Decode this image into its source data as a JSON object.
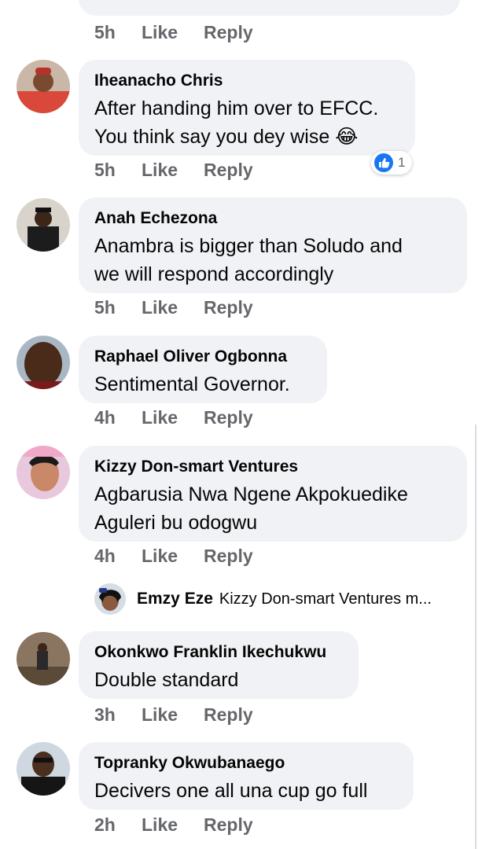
{
  "top_actions": {
    "time": "5h",
    "like": "Like",
    "reply": "Reply"
  },
  "comments": [
    {
      "author": "Iheanacho Chris",
      "lines": [
        "After handing him over to EFCC.",
        "You think say you dey wise 😂"
      ],
      "time": "5h",
      "like": "Like",
      "reply": "Reply",
      "reaction_count": "1"
    },
    {
      "author": "Anah Echezona",
      "lines": [
        "Anambra is bigger than Soludo and",
        "we will respond accordingly"
      ],
      "time": "5h",
      "like": "Like",
      "reply": "Reply"
    },
    {
      "author": "Raphael Oliver Ogbonna",
      "lines": [
        "Sentimental Governor."
      ],
      "time": "4h",
      "like": "Like",
      "reply": "Reply"
    },
    {
      "author": "Kizzy Don-smart Ventures",
      "lines": [
        "Agbarusia Nwa Ngene Akpokuedike",
        "Aguleri bu odogwu"
      ],
      "time": "4h",
      "like": "Like",
      "reply": "Reply"
    },
    {
      "author": "Okonkwo Franklin Ikechukwu",
      "lines": [
        "Double standard"
      ],
      "time": "3h",
      "like": "Like",
      "reply": "Reply"
    },
    {
      "author": "Topranky Okwubanaego",
      "lines": [
        "Decivers one all una cup go full"
      ],
      "time": "2h",
      "like": "Like",
      "reply": "Reply"
    }
  ],
  "reply_preview": {
    "author": "Emzy Eze",
    "text": "Kizzy Don-smart Ventures m..."
  },
  "colors": {
    "bubble": "#f0f2f5",
    "meta": "#65676b",
    "text": "#050505",
    "like_blue": "#1877f2"
  }
}
